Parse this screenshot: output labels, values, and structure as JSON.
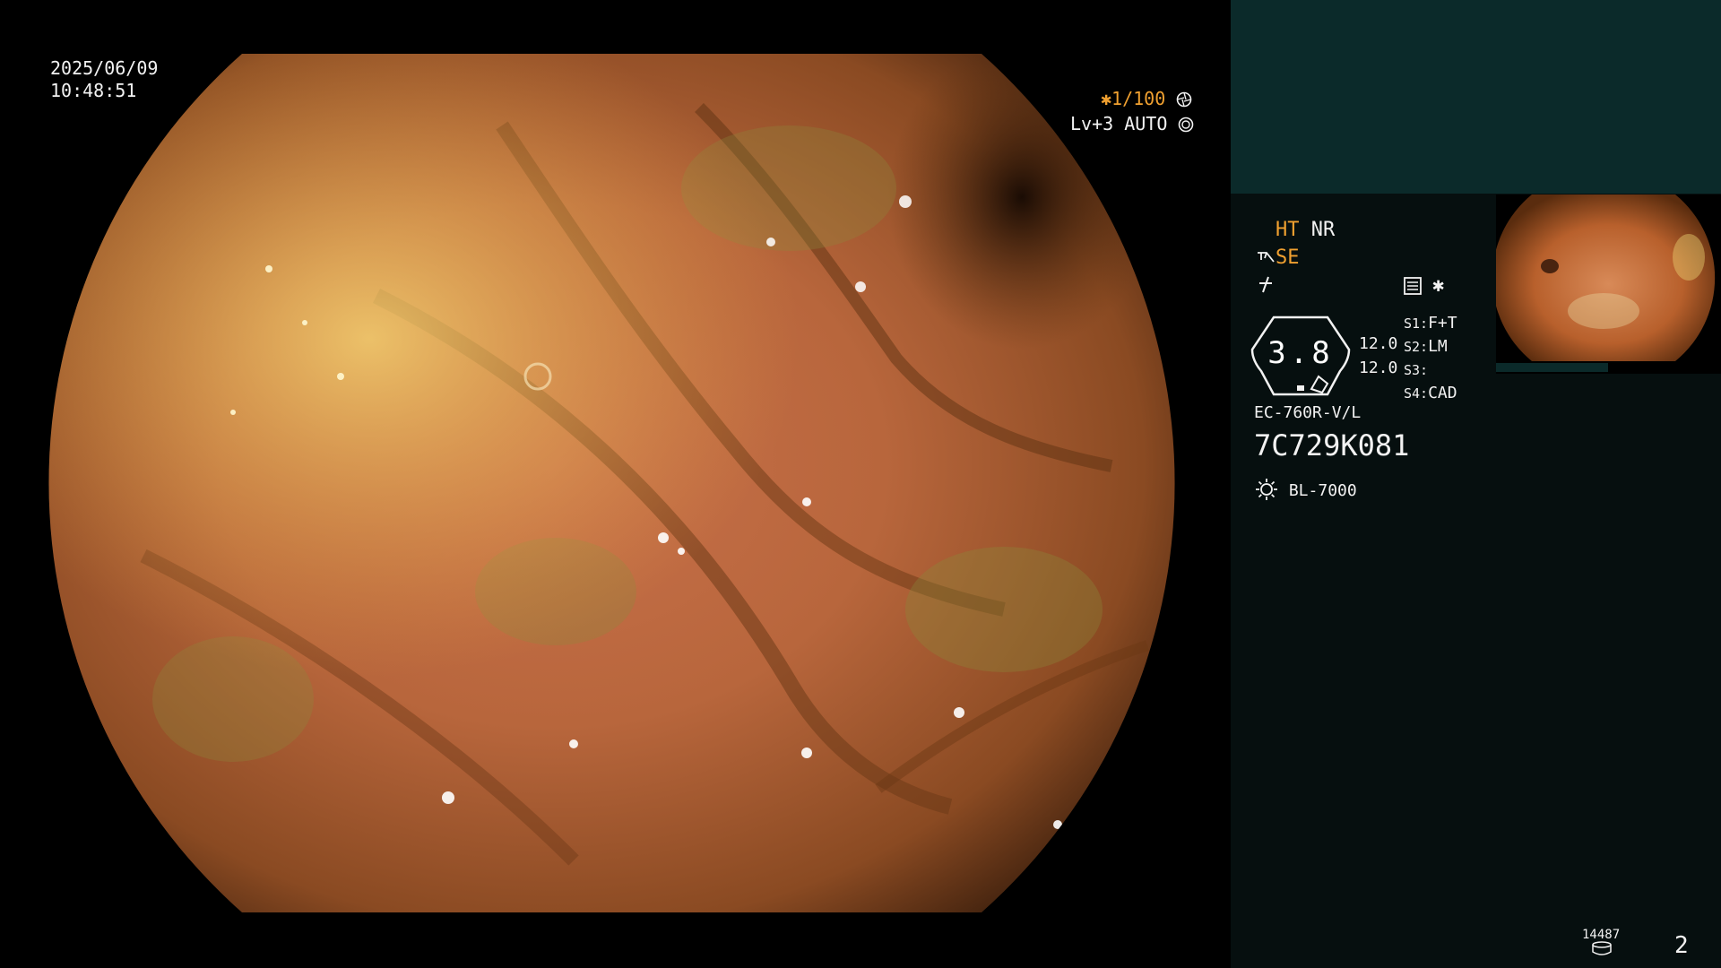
{
  "overlay": {
    "date": "2025/06/09",
    "time": "10:48:51",
    "shutter": "✱1/100",
    "shutter_icon": "aperture-icon",
    "exposure": "Lv+3 AUTO",
    "exposure_icon": "iris-icon"
  },
  "panel": {
    "ht_label": "HT",
    "nr_label": "NR",
    "se_label": "SE",
    "se_icon": "structure-enhance-icon",
    "freeze_icon": "freeze-icon",
    "color_icon": "color-mode-icon",
    "star_label": "✱",
    "magnification": "3.8",
    "mag_top": "12.0",
    "mag_bottom": "12.0",
    "switches": [
      {
        "key": "S1:",
        "value": "F+T"
      },
      {
        "key": "S2:",
        "value": "LM"
      },
      {
        "key": "S3:",
        "value": ""
      },
      {
        "key": "S4:",
        "value": "CAD"
      }
    ],
    "scope_model": "EC-760R-V/L",
    "scope_serial": "7C729K081",
    "light_source": "BL-7000",
    "light_icon": "light-source-icon",
    "image_count": "14487",
    "storage_icon": "storage-icon",
    "page_number": "2"
  },
  "colors": {
    "accent_orange": "#f0a030",
    "panel_top": "#0b2a2a",
    "panel_bg": "#060f0f"
  }
}
